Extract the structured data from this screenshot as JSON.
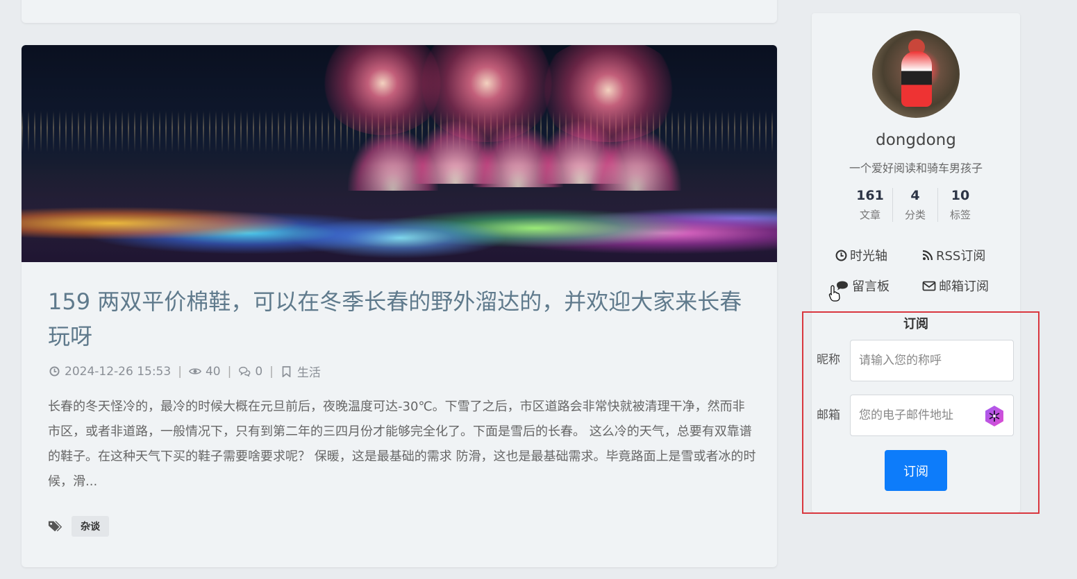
{
  "post": {
    "title": "159 两双平价棉鞋，可以在冬季长春的野外溜达的，并欢迎大家来长春玩呀",
    "date": "2024-12-26 15:53",
    "views": "40",
    "comments": "0",
    "category": "生活",
    "excerpt": "长春的冬天怪冷的，最冷的时候大概在元旦前后，夜晚温度可达-30℃。下雪了之后，市区道路会非常快就被清理干净，然而非市区，或者非道路，一般情况下，只有到第二年的三四月份才能够完全化了。下面是雪后的长春。 这么冷的天气，总要有双靠谱的鞋子。在这种天气下买的鞋子需要啥要求呢？ 保暖，这是最基础的需求 防滑，这也是最基础需求。毕竟路面上是雪或者冰的时候，滑...",
    "tags": [
      "杂谈"
    ],
    "cover_icon": "fireworks-ice-city-image"
  },
  "profile": {
    "name": "dongdong",
    "bio": "一个爱好阅读和骑车男孩子",
    "stats": [
      {
        "num": "161",
        "label": "文章"
      },
      {
        "num": "4",
        "label": "分类"
      },
      {
        "num": "10",
        "label": "标签"
      }
    ],
    "links": [
      {
        "label": "时光轴",
        "icon": "clock-icon"
      },
      {
        "label": "RSS订阅",
        "icon": "rss-icon"
      },
      {
        "label": "留言板",
        "icon": "comment-icon"
      },
      {
        "label": "邮箱订阅",
        "icon": "envelope-icon"
      }
    ]
  },
  "subscribe": {
    "title": "订阅",
    "nickname_label": "昵称",
    "nickname_placeholder": "请输入您的称呼",
    "email_label": "邮箱",
    "email_placeholder": "您的电子邮件地址",
    "button": "订阅"
  },
  "colors": {
    "accent": "#0d7cfa",
    "highlight_border": "#d9363e"
  }
}
